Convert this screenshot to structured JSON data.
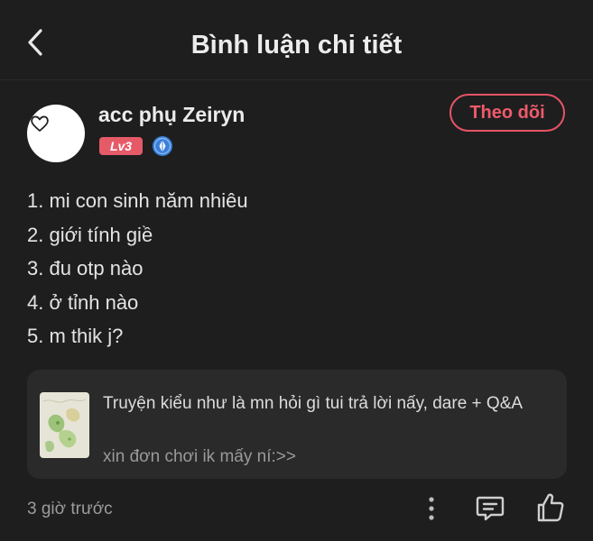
{
  "header": {
    "title": "Bình luận chi tiết",
    "back_icon": "chevron-left-icon"
  },
  "author": {
    "name": "acc phụ Zeiryn",
    "level": "Lv3",
    "avatar_icon": "heart-outline-icon",
    "verified_icon": "verified-badge-icon",
    "follow_label": "Theo dõi"
  },
  "comment": {
    "lines": [
      "1. mi con sinh năm nhiêu",
      "2. giới tính giề",
      "3. đu otp nào",
      "4. ở tỉnh nào",
      "5. m thik j?"
    ]
  },
  "story": {
    "title": "Truyện kiểu như là mn hỏi gì tui trả lời nấy, dare + Q&A",
    "author": "xin đơn chơi ik mấy ní:>>",
    "thumbnail_icon": "story-cover-image"
  },
  "footer": {
    "timestamp": "3 giờ trước",
    "more_icon": "more-vertical-icon",
    "reply_icon": "comment-icon",
    "like_icon": "thumbs-up-icon"
  },
  "colors": {
    "background": "#1e1e1f",
    "accent": "#e65465",
    "card": "#2a2a2b",
    "verified": "#3b7fd9"
  }
}
